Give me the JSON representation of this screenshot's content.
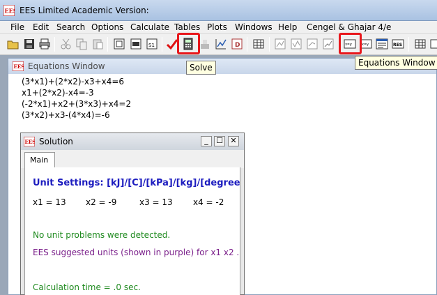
{
  "app": {
    "title": "EES Limited Academic Version:"
  },
  "menu": [
    "File",
    "Edit",
    "Search",
    "Options",
    "Calculate",
    "Tables",
    "Plots",
    "Windows",
    "Help",
    "Cengel & Ghajar 4/e"
  ],
  "tooltips": {
    "solve": "Solve",
    "equations_window": "Equations Window"
  },
  "equations_window": {
    "title": "Equations Window",
    "lines": [
      "(3*x1)+(2*x2)-x3+x4=6",
      "x1+(2*x2)-x4=-3",
      "(-2*x1)+x2+(3*x3)+x4=2",
      "(3*x2)+x3-(4*x4)=-6"
    ]
  },
  "solution_window": {
    "title": "Solution",
    "controls": {
      "minimize": "_",
      "maximize": "☐",
      "close": "✕"
    },
    "tab": "Main",
    "unit_settings": "Unit Settings: [kJ]/[C]/[kPa]/[kg]/[degrees]",
    "variables": [
      "x1 = 13",
      "x2 = -9",
      "x3 = 13",
      "x4 = -2"
    ],
    "unit_problems": "No unit problems were detected.",
    "suggested_units": "EES suggested units (shown in purple) for x1  x2  .",
    "calc_time": "Calculation time = .0 sec."
  },
  "colors": {
    "accent_blue": "#1c1cbf",
    "message_green": "#1f8a1f",
    "suggest_purple": "#7a1f8a",
    "highlight_red": "#e8171c"
  },
  "icons": [
    "ees-logo-icon",
    "open-folder-icon",
    "save-icon",
    "print-icon",
    "check-units-icon",
    "solve-calculator-icon",
    "equations-window-icon"
  ]
}
